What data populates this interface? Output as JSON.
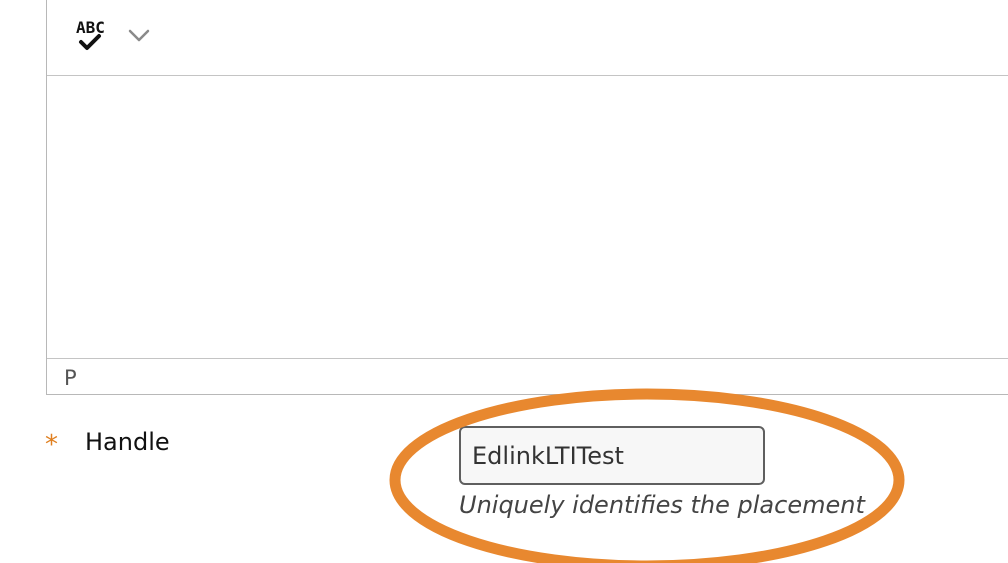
{
  "editor": {
    "toolbar": {
      "spellcheck_icon": "spellcheck-abc-icon",
      "spellcheck_text": "ABC",
      "dropdown_icon": "chevron-down-icon"
    },
    "content": "",
    "statusbar": {
      "path": "P"
    }
  },
  "handle_field": {
    "required_marker": "*",
    "label": "Handle",
    "value": "EdlinkLTITest",
    "help_text": "Uniquely identifies the placement"
  },
  "colors": {
    "required": "#e07f1f",
    "annotation_oval": "#e8882f",
    "border": "#b8b8b8",
    "input_border": "#5f5f5f"
  }
}
